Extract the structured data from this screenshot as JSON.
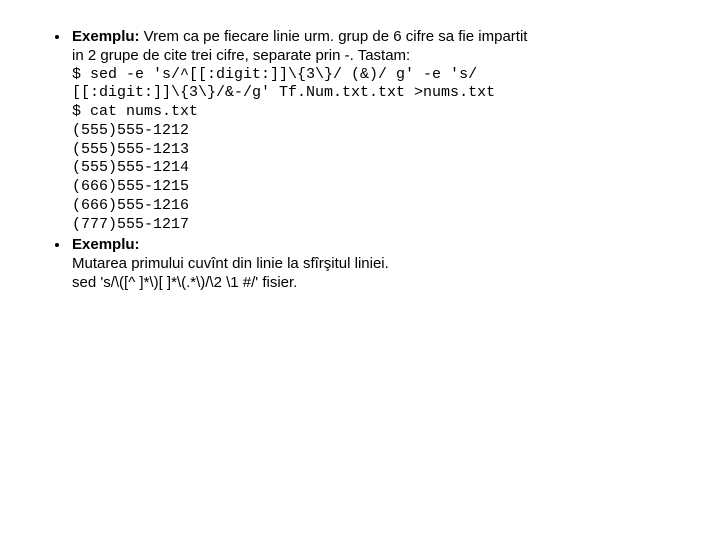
{
  "items": [
    {
      "label": "Exemplu:",
      "intro_line1_after_label": " Vrem ca pe fiecare linie urm. grup de 6 cifre sa fie impartit",
      "intro_line2": "in 2 grupe de cite trei cifre, separate prin -.  Tastam:",
      "code": [
        "$ sed -e 's/^[[:digit:]]\\{3\\}/ (&)/ g' -e 's/",
        "[[:digit:]]\\{3\\}/&-/g' Tf.Num.txt.txt >nums.txt",
        "$ cat nums.txt",
        "(555)555-1212",
        "(555)555-1213",
        "(555)555-1214",
        "(666)555-1215",
        "(666)555-1216",
        "(777)555-1217"
      ]
    },
    {
      "label": "Exemplu:",
      "body": [
        "Mutarea primului cuvînt din linie la sfîrşitul liniei.",
        "sed 's/\\([^ ]*\\)[ ]*\\(.*\\)/\\2 \\1 #/' fisier."
      ]
    }
  ]
}
